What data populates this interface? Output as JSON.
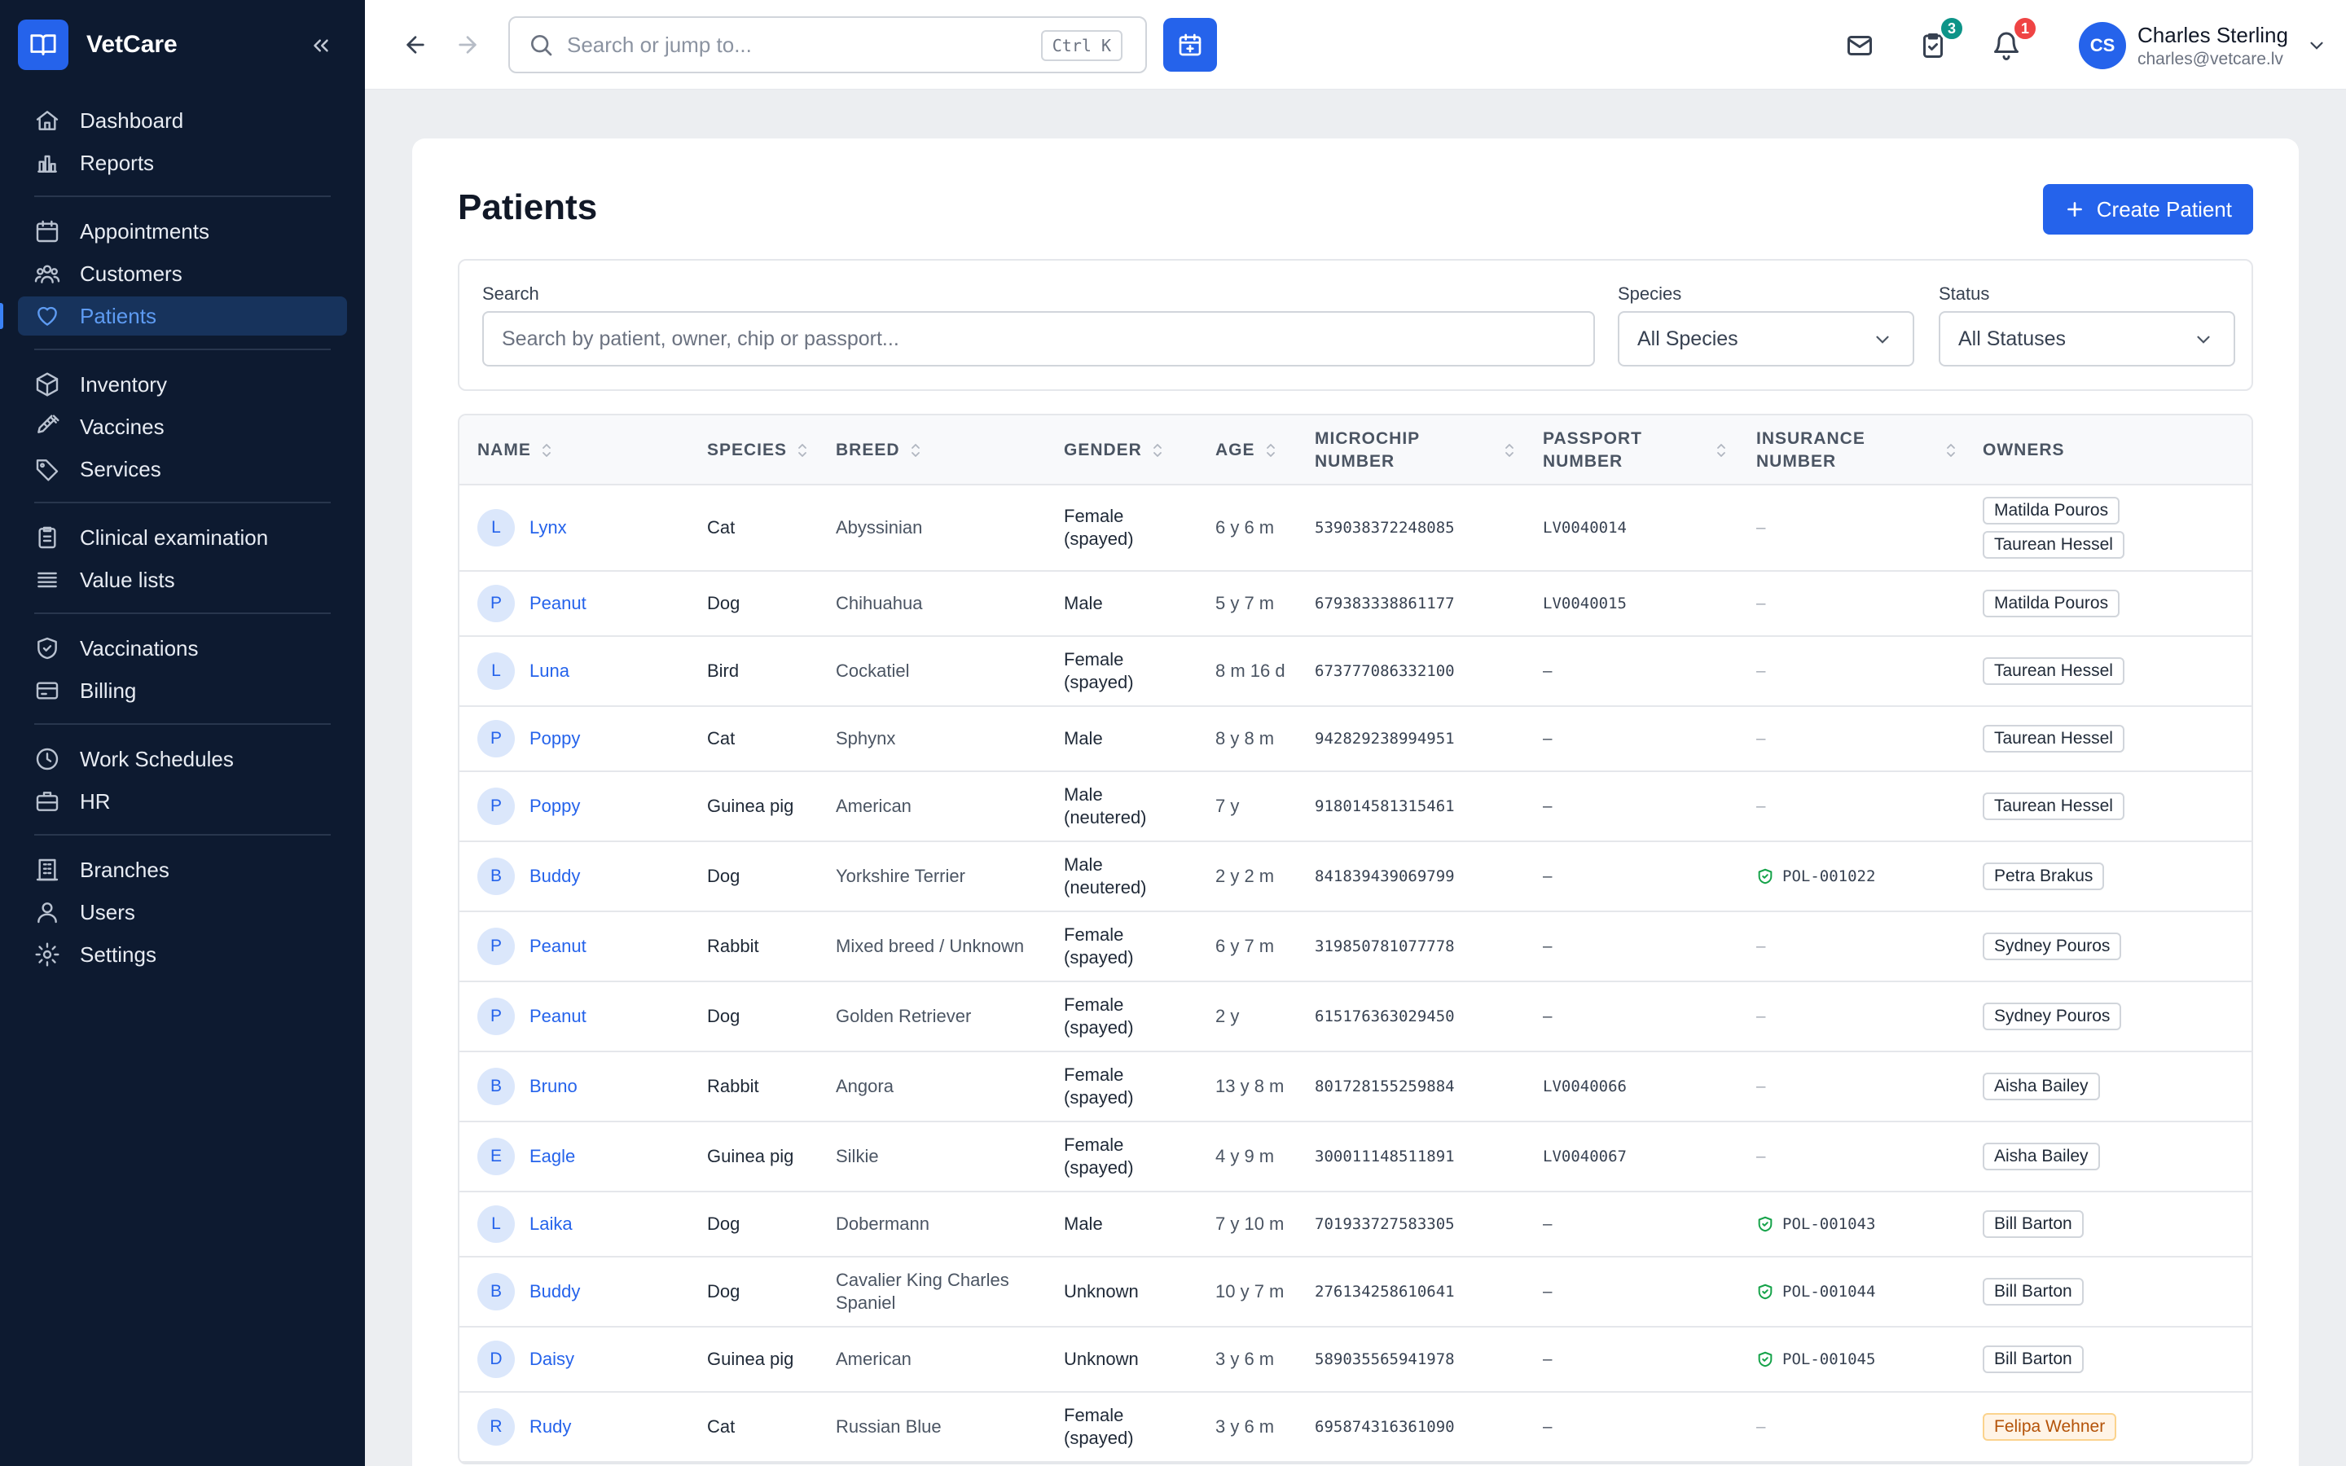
{
  "app": {
    "name": "VetCare"
  },
  "sidebar": {
    "groups": [
      [
        {
          "label": "Dashboard",
          "icon": "home-icon"
        },
        {
          "label": "Reports",
          "icon": "bar-chart-icon"
        }
      ],
      [
        {
          "label": "Appointments",
          "icon": "calendar-icon"
        },
        {
          "label": "Customers",
          "icon": "users-icon"
        },
        {
          "label": "Patients",
          "icon": "heart-icon",
          "active": true
        }
      ],
      [
        {
          "label": "Inventory",
          "icon": "box-icon"
        },
        {
          "label": "Vaccines",
          "icon": "syringe-icon"
        },
        {
          "label": "Services",
          "icon": "tag-icon"
        }
      ],
      [
        {
          "label": "Clinical examination",
          "icon": "clipboard-icon"
        },
        {
          "label": "Value lists",
          "icon": "list-icon"
        }
      ],
      [
        {
          "label": "Vaccinations",
          "icon": "shield-check-icon"
        },
        {
          "label": "Billing",
          "icon": "credit-card-icon"
        }
      ],
      [
        {
          "label": "Work Schedules",
          "icon": "clock-icon"
        },
        {
          "label": "HR",
          "icon": "briefcase-icon"
        }
      ],
      [
        {
          "label": "Branches",
          "icon": "building-icon"
        },
        {
          "label": "Users",
          "icon": "user-icon"
        },
        {
          "label": "Settings",
          "icon": "gear-icon"
        }
      ]
    ]
  },
  "topbar": {
    "search_placeholder": "Search or jump to...",
    "shortcut": "Ctrl K",
    "tasks_count": "3",
    "notifications_count": "1",
    "user": {
      "initials": "CS",
      "name": "Charles Sterling",
      "email": "charles@vetcare.lv"
    }
  },
  "page": {
    "title": "Patients",
    "create_label": "Create Patient",
    "filters": {
      "search_label": "Search",
      "search_placeholder": "Search by patient, owner, chip or passport...",
      "species_label": "Species",
      "species_value": "All Species",
      "status_label": "Status",
      "status_value": "All Statuses"
    }
  },
  "table": {
    "columns": [
      {
        "key": "name",
        "label": "NAME"
      },
      {
        "key": "species",
        "label": "SPECIES"
      },
      {
        "key": "breed",
        "label": "BREED"
      },
      {
        "key": "gender",
        "label": "GENDER"
      },
      {
        "key": "age",
        "label": "AGE"
      },
      {
        "key": "microchip",
        "label": "MICROCHIP NUMBER"
      },
      {
        "key": "passport",
        "label": "PASSPORT NUMBER"
      },
      {
        "key": "insurance",
        "label": "INSURANCE NUMBER"
      },
      {
        "key": "owners",
        "label": "OWNERS"
      }
    ],
    "rows": [
      {
        "initial": "L",
        "name": "Lynx",
        "species": "Cat",
        "breed": "Abyssinian",
        "gender": "Female (spayed)",
        "age": "6 y 6 m",
        "microchip": "539038372248085",
        "passport": "LV0040014",
        "insurance": "—",
        "owners": [
          "Matilda Pouros",
          "Taurean Hessel"
        ]
      },
      {
        "initial": "P",
        "name": "Peanut",
        "species": "Dog",
        "breed": "Chihuahua",
        "gender": "Male",
        "age": "5 y 7 m",
        "microchip": "679383338861177",
        "passport": "LV0040015",
        "insurance": "—",
        "owners": [
          "Matilda Pouros"
        ]
      },
      {
        "initial": "L",
        "name": "Luna",
        "species": "Bird",
        "breed": "Cockatiel",
        "gender": "Female (spayed)",
        "age": "8 m 16 d",
        "microchip": "673777086332100",
        "passport": "–",
        "insurance": "—",
        "owners": [
          "Taurean Hessel"
        ]
      },
      {
        "initial": "P",
        "name": "Poppy",
        "species": "Cat",
        "breed": "Sphynx",
        "gender": "Male",
        "age": "8 y 8 m",
        "microchip": "942829238994951",
        "passport": "–",
        "insurance": "—",
        "owners": [
          "Taurean Hessel"
        ]
      },
      {
        "initial": "P",
        "name": "Poppy",
        "species": "Guinea pig",
        "breed": "American",
        "gender": "Male (neutered)",
        "age": "7 y",
        "microchip": "918014581315461",
        "passport": "–",
        "insurance": "—",
        "owners": [
          "Taurean Hessel"
        ]
      },
      {
        "initial": "B",
        "name": "Buddy",
        "species": "Dog",
        "breed": "Yorkshire Terrier",
        "gender": "Male (neutered)",
        "age": "2 y 2 m",
        "microchip": "841839439069799",
        "passport": "–",
        "insurance": "POL-001022",
        "owners": [
          "Petra Brakus"
        ]
      },
      {
        "initial": "P",
        "name": "Peanut",
        "species": "Rabbit",
        "breed": "Mixed breed / Unknown",
        "gender": "Female (spayed)",
        "age": "6 y 7 m",
        "microchip": "319850781077778",
        "passport": "–",
        "insurance": "—",
        "owners": [
          "Sydney Pouros"
        ]
      },
      {
        "initial": "P",
        "name": "Peanut",
        "species": "Dog",
        "breed": "Golden Retriever",
        "gender": "Female (spayed)",
        "age": "2 y",
        "microchip": "615176363029450",
        "passport": "–",
        "insurance": "—",
        "owners": [
          "Sydney Pouros"
        ]
      },
      {
        "initial": "B",
        "name": "Bruno",
        "species": "Rabbit",
        "breed": "Angora",
        "gender": "Female (spayed)",
        "age": "13 y 8 m",
        "microchip": "801728155259884",
        "passport": "LV0040066",
        "insurance": "—",
        "owners": [
          "Aisha Bailey"
        ]
      },
      {
        "initial": "E",
        "name": "Eagle",
        "species": "Guinea pig",
        "breed": "Silkie",
        "gender": "Female (spayed)",
        "age": "4 y 9 m",
        "microchip": "300011148511891",
        "passport": "LV0040067",
        "insurance": "—",
        "owners": [
          "Aisha Bailey"
        ]
      },
      {
        "initial": "L",
        "name": "Laika",
        "species": "Dog",
        "breed": "Dobermann",
        "gender": "Male",
        "age": "7 y 10 m",
        "microchip": "701933727583305",
        "passport": "–",
        "insurance": "POL-001043",
        "owners": [
          "Bill Barton"
        ]
      },
      {
        "initial": "B",
        "name": "Buddy",
        "species": "Dog",
        "breed": "Cavalier King Charles Spaniel",
        "gender": "Unknown",
        "age": "10 y 7 m",
        "microchip": "276134258610641",
        "passport": "–",
        "insurance": "POL-001044",
        "owners": [
          "Bill Barton"
        ]
      },
      {
        "initial": "D",
        "name": "Daisy",
        "species": "Guinea pig",
        "breed": "American",
        "gender": "Unknown",
        "age": "3 y 6 m",
        "microchip": "589035565941978",
        "passport": "–",
        "insurance": "POL-001045",
        "owners": [
          "Bill Barton"
        ]
      },
      {
        "initial": "R",
        "name": "Rudy",
        "species": "Cat",
        "breed": "Russian Blue",
        "gender": "Female (spayed)",
        "age": "3 y 6 m",
        "microchip": "695874316361090",
        "passport": "–",
        "insurance": "—",
        "owners": [
          "Felipa Wehner"
        ],
        "owner_warn": true
      }
    ]
  }
}
